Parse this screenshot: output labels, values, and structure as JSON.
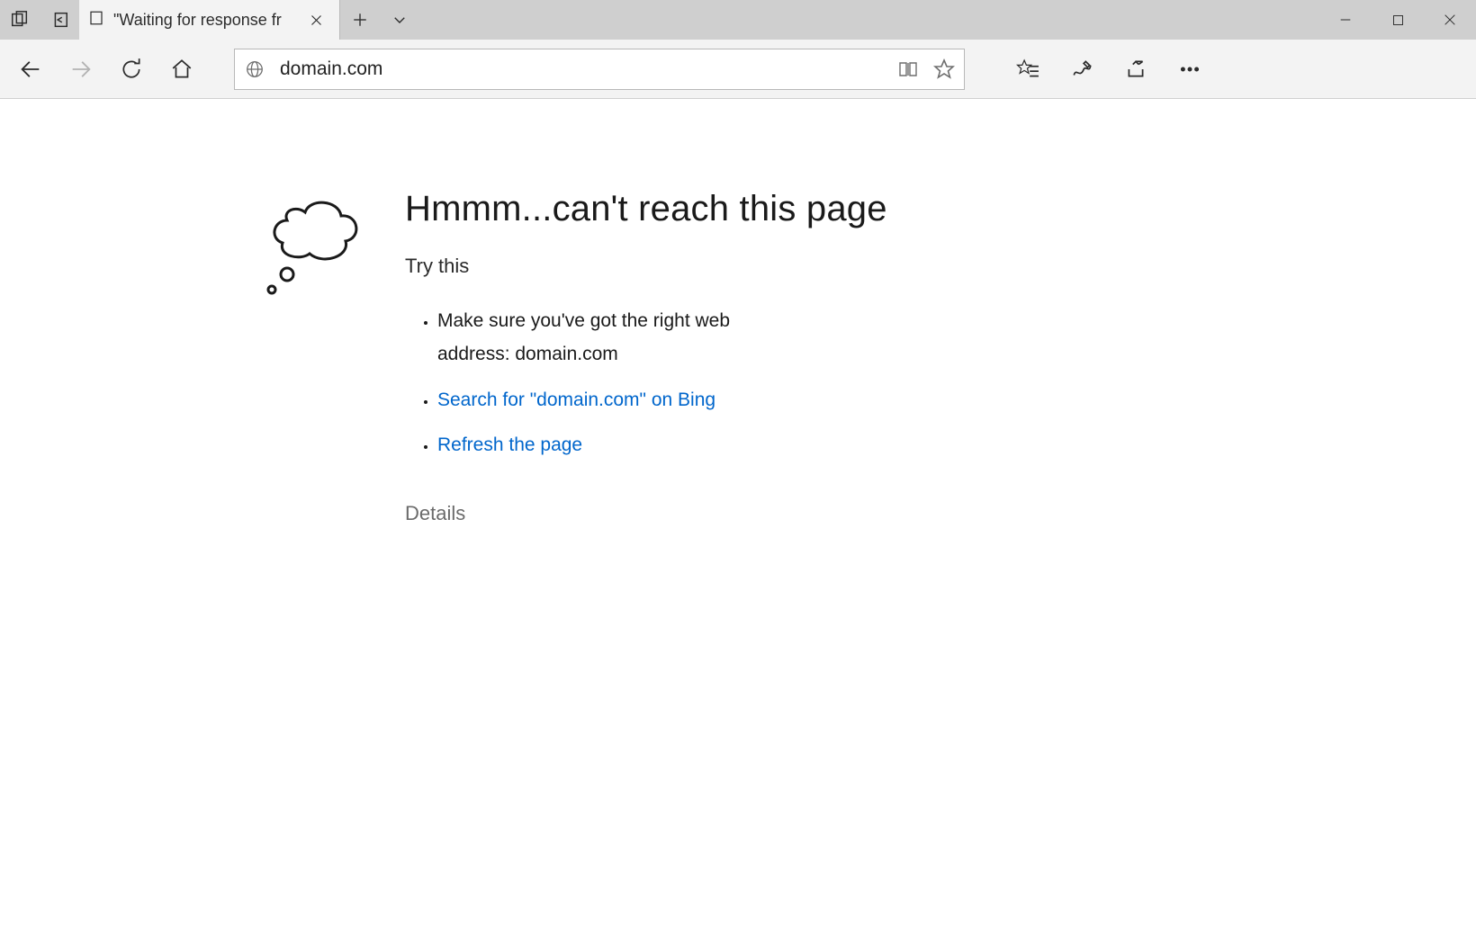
{
  "tab": {
    "title": "\"Waiting for response fr"
  },
  "address_bar": {
    "url": "domain.com"
  },
  "error": {
    "heading": "Hmmm...can't reach this page",
    "try_this": "Try this",
    "suggestion_address": "Make sure you've got the right web address: domain.com",
    "suggestion_search": "Search for \"domain.com\" on Bing",
    "suggestion_refresh": "Refresh the page",
    "details_label": "Details"
  }
}
